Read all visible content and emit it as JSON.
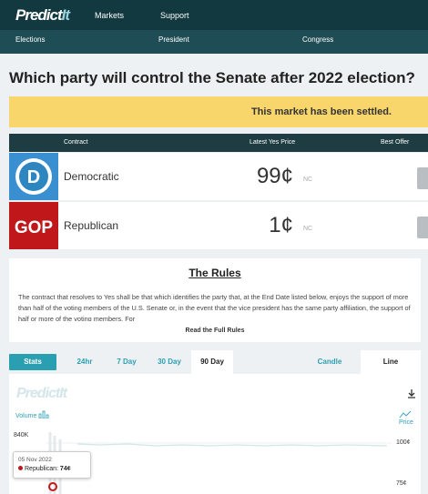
{
  "nav": {
    "logo_main": "Predict",
    "logo_it": "It",
    "top_links": [
      "Markets",
      "Support"
    ],
    "sub_links": [
      "Elections",
      "President",
      "Congress"
    ]
  },
  "market": {
    "title": "Which party will control the Senate after 2022 election?",
    "status": "This market has been settled."
  },
  "table": {
    "headers": {
      "contract": "Contract",
      "price": "Latest Yes Price",
      "offer": "Best Offer"
    },
    "rows": [
      {
        "name": "Democratic",
        "price": "99¢",
        "change": "NC",
        "color": "#2e86c1"
      },
      {
        "name": "Republican",
        "price": "1¢",
        "change": "NC",
        "color": "#c0171a"
      }
    ]
  },
  "rules": {
    "title": "The Rules",
    "text": "The contract that resolves to Yes shall be that which identifies the party that, at the End Date listed below, enjoys the support of more than half of the voting members of the U.S. Senate or, in the event that the vice president has the same party affiliation, the support of half or more of the voting members. For",
    "read_more": "Read the Full Rules"
  },
  "chart_tabs": {
    "stats": "Stats",
    "ranges": [
      "24hr",
      "7 Day",
      "30 Day",
      "90 Day"
    ],
    "active_range": "90 Day",
    "types": [
      "Candle",
      "Line"
    ],
    "active_type": "Line"
  },
  "chart": {
    "watermark": "PredictIt",
    "volume_label": "Volume",
    "price_label": "Price",
    "volume_tick": "840K",
    "price_ticks": [
      "100¢",
      "75¢"
    ],
    "tooltip_date": "05 Nov 2022",
    "tooltip_series": "Republican:",
    "tooltip_value": "74¢"
  },
  "colors": {
    "brand_dark": "#12393f",
    "accent": "#2a9fb2",
    "settled": "#f9d66b",
    "republican": "#c0171a",
    "democratic": "#2e86c1"
  }
}
